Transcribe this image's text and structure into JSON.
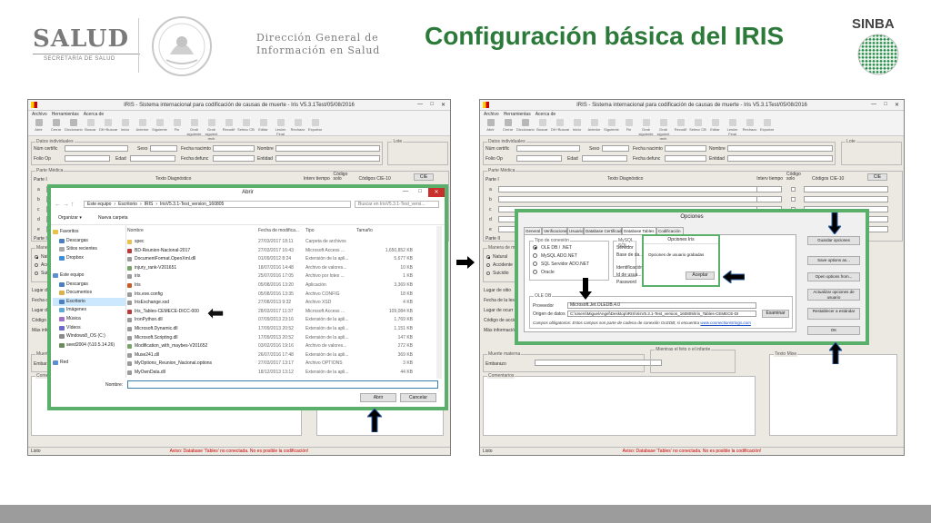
{
  "header": {
    "salud": "SALUD",
    "salud_sub": "SECRETARÍA DE SALUD",
    "dgis_line1": "Dirección General de",
    "dgis_line2": "Información en Salud",
    "title": "Configuración básica del IRIS",
    "sinba": "SINBA",
    "accent_green": "#2c7a3a",
    "frame_green": "#5ab06a"
  },
  "iris": {
    "title": "IRIS - Sistema internacional para codificación de causas de muerte - Iris V5.3.1Test/05/08/2016",
    "menu": [
      "Archivo",
      "Herramientas",
      "Acerca de"
    ],
    "toolbar": [
      {
        "icon": "open-icon",
        "label": "Abrir"
      },
      {
        "icon": "close-icon",
        "label": "Cerrar"
      },
      {
        "icon": "dictionary-icon",
        "label": "Diccionario"
      },
      {
        "icon": "search-icon",
        "label": "Buscar"
      },
      {
        "icon": "dk-buscar-icon",
        "label": "DK+Buscar"
      },
      {
        "icon": "home-icon",
        "label": "Inicio"
      },
      {
        "icon": "previous-icon",
        "label": "Anterior"
      },
      {
        "icon": "next-icon",
        "label": "Siguiente"
      },
      {
        "icon": "end-icon",
        "label": "Fin"
      },
      {
        "icon": "save-next-icon",
        "label": "Grab siguiente"
      },
      {
        "icon": "save-next-rech-icon",
        "label": "Grab siguient rech"
      },
      {
        "icon": "recode-icon",
        "label": "Recodif"
      },
      {
        "icon": "select-cb-icon",
        "label": "Selecc CB"
      },
      {
        "icon": "edit-icon",
        "label": "Editar"
      },
      {
        "icon": "final-lesion-icon",
        "label": "Lesión Final"
      },
      {
        "icon": "reject-icon",
        "label": "Rechazo"
      },
      {
        "icon": "export-icon",
        "label": "Exportar"
      }
    ],
    "datos_legend": "Datos individuales",
    "lote_legend": "Lote",
    "num_certif": "Núm certific",
    "sexo": "Sexo",
    "fecha_nac": "Fecha nacimto",
    "nombre": "Nombre",
    "folio": "Folio Op",
    "edad": "Edad",
    "fecha_def": "Fecha defunc",
    "entidad": "Entidad",
    "parte_medica": "Parte Médica",
    "parte_i": "Parte I",
    "parte_ii": "Parte II",
    "texto_diag": "Texto Diagnóstico",
    "intervalo": "Interv tiempo",
    "codigo_solo": "Código solo",
    "codigos_cie": "Códigos CIE-10",
    "cie_btn": "CIE",
    "rows": [
      "a",
      "b",
      "c",
      "d",
      "e"
    ],
    "manera_muerte": "Manera de muerte",
    "natural": "Natural",
    "accidente": "Accidente",
    "suicidio": "Suicidio",
    "lugar_sitio": "Lugar de sitio",
    "fecha_lesion": "Fecha de la lesión",
    "lugar_ocurr": "Lugar de ocurr",
    "codigo_accion": "Código de acción",
    "mas_info": "Más información",
    "muerte_materna": "Muerte materna",
    "embarazo": "Embarazo",
    "comentarios": "Comentarios",
    "texto_mixe": "Texto Mixe",
    "fetal_label": "Mientras el feto o el infante",
    "status_left": "Listo",
    "status_msg": "Aviso: Database 'Tables' no conectada. No es posible la codificación!"
  },
  "open_dialog": {
    "title": "Abrir",
    "path": [
      "Este equipo",
      "Escritorio",
      "IRIS",
      "IrisV5.3.1-Test_version_160805"
    ],
    "search_placeholder": "Buscar en IrisV5.3.1-Test_versi...",
    "organize": "Organizar ▾",
    "new_folder": "Nueva carpeta",
    "nav": [
      {
        "label": "Favoritos",
        "color": "#e8c24a",
        "indent": 0
      },
      {
        "label": "Descargas",
        "color": "#4a7fc1",
        "indent": 1
      },
      {
        "label": "Sitios recientes",
        "color": "#a8a8a8",
        "indent": 1
      },
      {
        "label": "Dropbox",
        "color": "#3d8fdc",
        "indent": 1
      },
      {
        "label": "",
        "color": "",
        "indent": 0
      },
      {
        "label": "Este equipo",
        "color": "#5b8fd0",
        "indent": 0
      },
      {
        "label": "Descargas",
        "color": "#4a7fc1",
        "indent": 1
      },
      {
        "label": "Documentos",
        "color": "#d9b24a",
        "indent": 1
      },
      {
        "label": "Escritorio",
        "color": "#4a7fc1",
        "indent": 1,
        "selected": true
      },
      {
        "label": "Imágenes",
        "color": "#5fa9d6",
        "indent": 1
      },
      {
        "label": "Música",
        "color": "#a070c8",
        "indent": 1
      },
      {
        "label": "Vídeos",
        "color": "#6a6ad0",
        "indent": 1
      },
      {
        "label": "Windows8_OS (C:)",
        "color": "#8a8a8a",
        "indent": 1
      },
      {
        "label": "seed2004 (\\\\10.5.14.26)",
        "color": "#6b8a5a",
        "indent": 1
      },
      {
        "label": "",
        "color": "",
        "indent": 0
      },
      {
        "label": "Red",
        "color": "#5b8fd0",
        "indent": 0
      }
    ],
    "columns": [
      "Nombre",
      "Fecha de modifica...",
      "Tipo",
      "Tamaño"
    ],
    "files": [
      {
        "name": "spec",
        "date": "27/03/2017 18:11",
        "type": "Carpeta de archivos",
        "size": "",
        "color": "#e8c24a"
      },
      {
        "name": "BD-Reunion-Nacional-2017",
        "date": "27/03/2017 16:43",
        "type": "Microsoft Access ...",
        "size": "1,650,852 KB",
        "color": "#b83a3a"
      },
      {
        "name": "DocumentFormat.OpenXml.dll",
        "date": "01/09/2012 8:24",
        "type": "Extensión de la apli...",
        "size": "5,677 KB",
        "color": "#9a9a9a"
      },
      {
        "name": "injury_rank-V201651",
        "date": "18/07/2016 14:48",
        "type": "Archivo de valores...",
        "size": "10 KB",
        "color": "#7aa36a"
      },
      {
        "name": "iris",
        "date": "25/07/2016 17:05",
        "type": "Archivo por lotes ...",
        "size": "1 KB",
        "color": "#9a9a9a"
      },
      {
        "name": "Iris",
        "date": "05/08/2016 13:20",
        "type": "Aplicación",
        "size": "3,369 KB",
        "color": "#c85a28"
      },
      {
        "name": "Iris.exe.config",
        "date": "05/08/2016 13:35",
        "type": "Archivo CONFIG",
        "size": "18 KB",
        "color": "#9a9a9a"
      },
      {
        "name": "IrisExchange.xsd",
        "date": "27/08/2013 9:32",
        "type": "Archivo XSD",
        "size": "4 KB",
        "color": "#9a9a9a"
      },
      {
        "name": "Iris_Tables-CEMECE-DICC-000",
        "date": "28/03/2017 11:37",
        "type": "Microsoft Access ...",
        "size": "109,084 KB",
        "color": "#b83a3a"
      },
      {
        "name": "IronPython.dll",
        "date": "07/09/2013 23:16",
        "type": "Extensión de la apli...",
        "size": "1,769 KB",
        "color": "#9a9a9a"
      },
      {
        "name": "Microsoft.Dynamic.dll",
        "date": "17/09/2013 20:52",
        "type": "Extensión de la apli...",
        "size": "1,151 KB",
        "color": "#9a9a9a"
      },
      {
        "name": "Microsoft.Scripting.dll",
        "date": "17/09/2013 20:52",
        "type": "Extensión de la apli...",
        "size": "147 KB",
        "color": "#9a9a9a"
      },
      {
        "name": "Modification_with_maybes-V201652",
        "date": "03/02/2016 19:16",
        "type": "Archivo de valores...",
        "size": "272 KB",
        "color": "#7aa36a"
      },
      {
        "name": "Muse241.dll",
        "date": "26/07/2016 17:48",
        "type": "Extensión de la apli...",
        "size": "369 KB",
        "color": "#9a9a9a"
      },
      {
        "name": "MyOptions_Reunion_Nacional.options",
        "date": "27/03/2017 13:17",
        "type": "Archivo OPTIONS",
        "size": "3 KB",
        "color": "#9a9a9a"
      },
      {
        "name": "MyOwnData.dll",
        "date": "18/12/2013 13:12",
        "type": "Extensión de la apli...",
        "size": "44 KB",
        "color": "#9a9a9a"
      }
    ],
    "filename_label": "Nombre:",
    "open_btn": "Abrir",
    "cancel_btn": "Cancelar"
  },
  "options_dialog": {
    "title": "Opciones",
    "tabs": [
      "General",
      "Verificaciones",
      "Usuario",
      "Database Certificado",
      "Database Tables",
      "Codificación"
    ],
    "selected_tab": "Database Tables",
    "tipo_conexion": "Tipo de conexión",
    "radios": [
      "OLE DB / .NET",
      "MySQL ADO.NET",
      "SQL Servidor ADO.NET",
      "Oracle"
    ],
    "mysql_legend": "MySQL, SQL...",
    "servidor": "Servidor",
    "base_datos": "Base de da...",
    "identificacion": "Identificación",
    "id_usuario": "Id de usua...",
    "password": "Password",
    "ole_db": "OLE DB",
    "proveedor": "Proveedor",
    "proveedor_value": "Microsoft.Jet.OLEDB.4.0",
    "origen": "Origen de datos",
    "origen_value": "C:\\Users\\MiguelAngel\\Desktop\\IRIS\\IrisV5.3.1-Test_version_160805\\Iris_Tables-CEMECE-DI",
    "examinar": "Examinar",
    "note": "Campos obligatorios: Estos campos son parte de cadena de conexión OLEDB; si encuentra",
    "note_link": "www.connectionstrings.com",
    "buttons": [
      "Guardar opciones",
      "Save options as...",
      "Open options from...",
      "Actualizar opciones de usuario",
      "Restablecer a estándar",
      "OK"
    ],
    "popup_title": "Opciones Iris",
    "popup_msg": "Opciones de usuario grabadas",
    "popup_btn": "Aceptar"
  }
}
